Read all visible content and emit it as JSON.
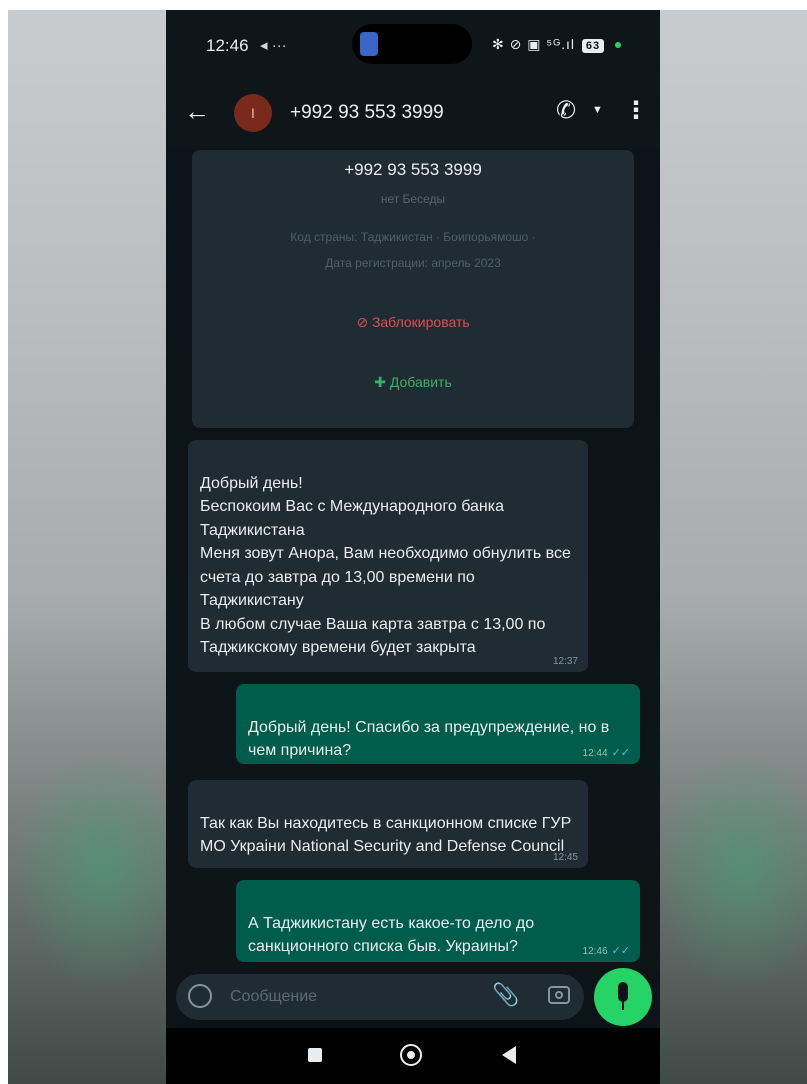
{
  "status_bar": {
    "time": "12:46",
    "time_extra": "◂ ···",
    "icons": "✻ ⊘ ▣ ⁵ᴳ.ıl",
    "battery": "63"
  },
  "header": {
    "back_icon": "arrow-left-icon",
    "avatar_letter": "I",
    "contact_name": "+992 93 553 3999",
    "call_icon": "phone-icon",
    "menu_icon": "more-vertical-icon"
  },
  "info_card": {
    "number": "+992 93 553 3999",
    "subtitle": "нет Беседы",
    "line1": "Код страны: Таджикистан · Боипорьямошо ·",
    "line2": "Дата регистрации: апрель 2023",
    "block_label": "Заблокировать",
    "add_label": "Добавить"
  },
  "messages": [
    {
      "direction": "incoming",
      "text": "Добрый день!\nБеспокоим Вас с Международного банка Таджикистана\nМеня зовут Анора, Вам необходимо обнулить все счета до завтра до 13,00 времени по Таджикистану\nВ любом случае Ваша карта завтра с 13,00 по Таджикскому времени будет закрыта",
      "time": "12:37"
    },
    {
      "direction": "outgoing",
      "text": "Добрый день! Спасибо за предупреждение, но в чем причина?",
      "time": "12:44",
      "ticks": "✓✓"
    },
    {
      "direction": "incoming",
      "text": "Так как Вы находитесь в санкционном списке ГУР МО Украіни National Security and Defense Council",
      "time": "12:45"
    },
    {
      "direction": "outgoing",
      "text": "А Таджикистану есть какое-то дело до санкционного списка быв. Украины?",
      "time": "12:46",
      "ticks": "✓✓"
    }
  ],
  "composer": {
    "placeholder": "Сообщение",
    "attach_icon": "paperclip-icon",
    "camera_icon": "camera-icon",
    "mic_icon": "microphone-icon"
  },
  "navigation": {
    "recents_icon": "square-icon",
    "home_icon": "circle-icon",
    "back_icon": "triangle-back-icon"
  },
  "colors": {
    "background": "#0d1418",
    "incoming_bubble": "#1f2c33",
    "outgoing_bubble": "#005c4b",
    "accent_green": "#25d366",
    "block_red": "#d8504f"
  }
}
